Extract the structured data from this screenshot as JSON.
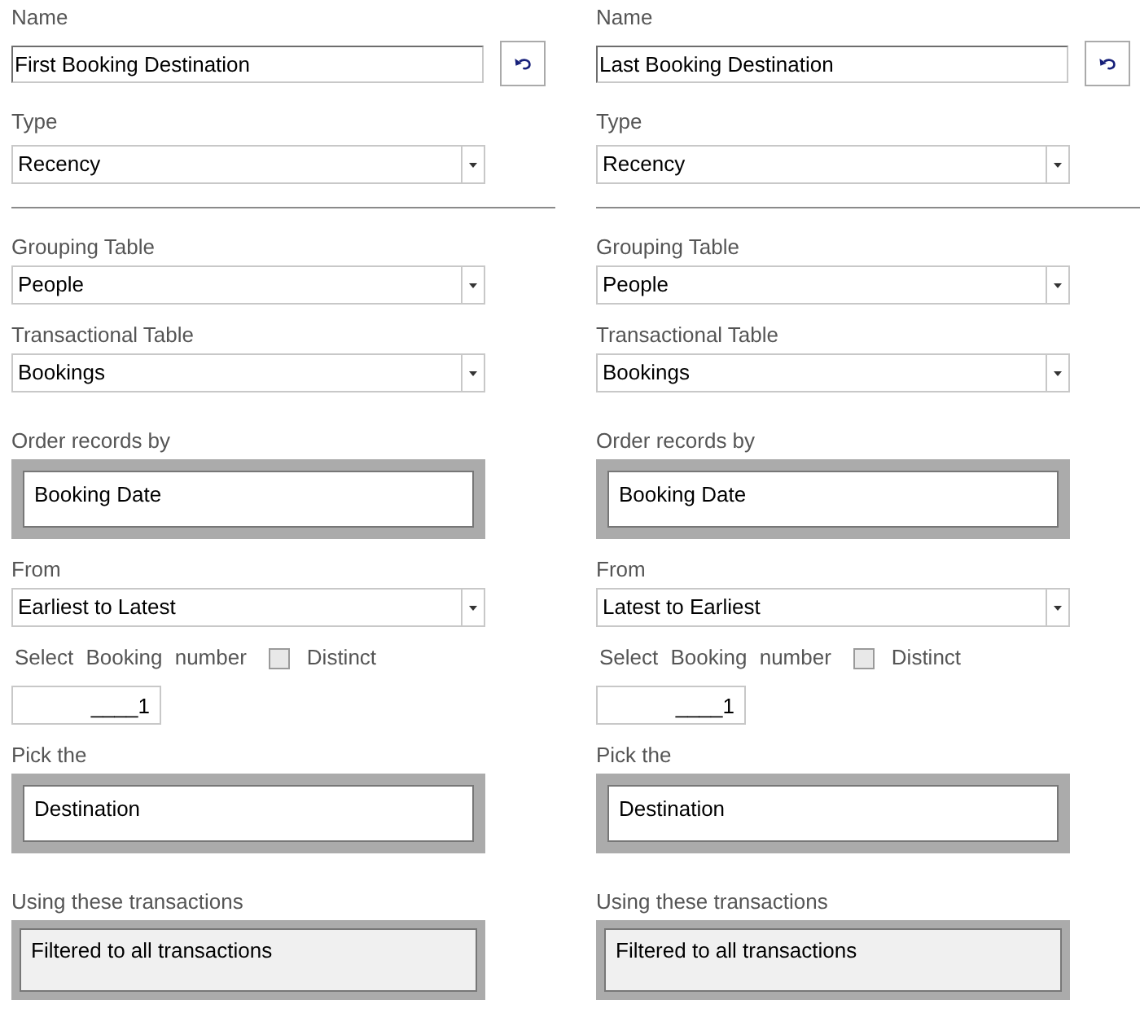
{
  "panels": [
    {
      "sections": [
        {
          "rule": true,
          "fields": [
            {
              "kind": "name",
              "label": "Name",
              "value": "First Booking Destination"
            },
            {
              "kind": "select",
              "label": "Type",
              "value": "Recency"
            }
          ]
        },
        {
          "rule": false,
          "fields": [
            {
              "kind": "select",
              "label": "Grouping Table",
              "value": "People"
            },
            {
              "kind": "select",
              "label": "Transactional Table",
              "value": "Bookings"
            }
          ]
        },
        {
          "rule": false,
          "fields": [
            {
              "kind": "picker",
              "label": "Order records by",
              "value": "Booking Date"
            },
            {
              "kind": "select",
              "label": "From",
              "value": "Earliest to Latest"
            },
            {
              "kind": "number",
              "label": "Select Booking number",
              "checkbox_label": "Distinct",
              "checked": false,
              "value": "____1"
            },
            {
              "kind": "picker",
              "label": "Pick the",
              "value": "Destination"
            }
          ]
        },
        {
          "rule": false,
          "fields": [
            {
              "kind": "filter",
              "label": "Using these transactions",
              "value": "Filtered to all transactions"
            }
          ]
        }
      ]
    },
    {
      "sections": [
        {
          "rule": true,
          "fields": [
            {
              "kind": "name",
              "label": "Name",
              "value": "Last Booking Destination"
            },
            {
              "kind": "select",
              "label": "Type",
              "value": "Recency"
            }
          ]
        },
        {
          "rule": false,
          "fields": [
            {
              "kind": "select",
              "label": "Grouping Table",
              "value": "People"
            },
            {
              "kind": "select",
              "label": "Transactional Table",
              "value": "Bookings"
            }
          ]
        },
        {
          "rule": false,
          "fields": [
            {
              "kind": "picker",
              "label": "Order records by",
              "value": "Booking Date"
            },
            {
              "kind": "select",
              "label": "From",
              "value": "Latest to Earliest"
            },
            {
              "kind": "number",
              "label": "Select Booking number",
              "checkbox_label": "Distinct",
              "checked": false,
              "value": "____1"
            },
            {
              "kind": "picker",
              "label": "Pick the",
              "value": "Destination"
            }
          ]
        },
        {
          "rule": false,
          "fields": [
            {
              "kind": "filter",
              "label": "Using these transactions",
              "value": "Filtered to all transactions"
            }
          ]
        }
      ]
    }
  ]
}
